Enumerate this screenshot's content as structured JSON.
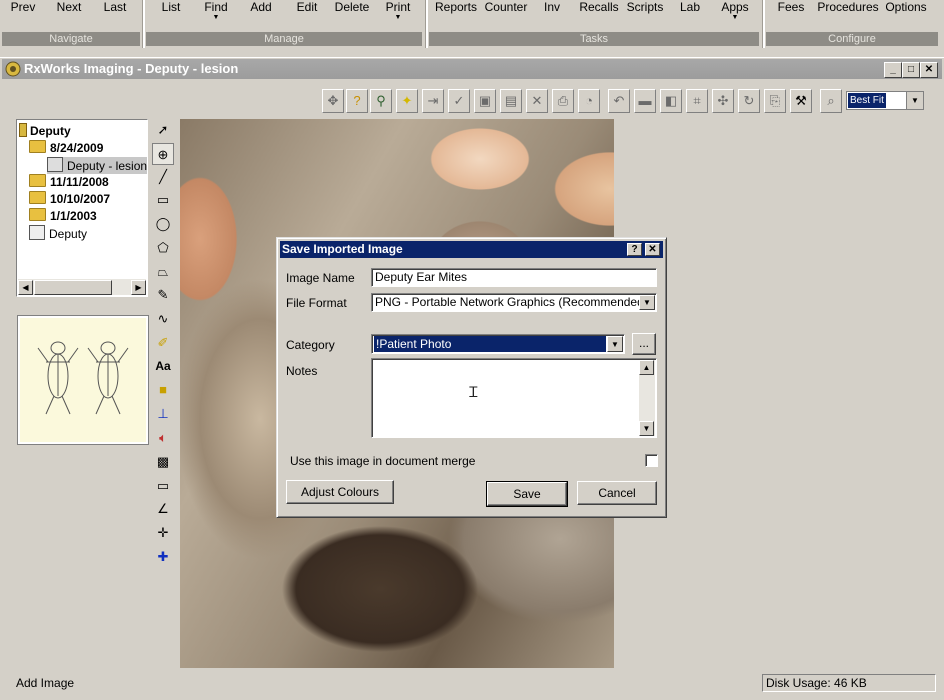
{
  "ribbon": {
    "buttons": [
      {
        "label": "Prev",
        "dropdown": false
      },
      {
        "label": "Next",
        "dropdown": false
      },
      {
        "label": "Last",
        "dropdown": false
      },
      {
        "label": "List",
        "dropdown": false
      },
      {
        "label": "Find",
        "dropdown": true
      },
      {
        "label": "Add",
        "dropdown": false
      },
      {
        "label": "Edit",
        "dropdown": false
      },
      {
        "label": "Delete",
        "dropdown": false
      },
      {
        "label": "Print",
        "dropdown": true
      },
      {
        "label": "Reports",
        "dropdown": false
      },
      {
        "label": "Counter",
        "dropdown": false
      },
      {
        "label": "Inv",
        "dropdown": false
      },
      {
        "label": "Recalls",
        "dropdown": false
      },
      {
        "label": "Scripts",
        "dropdown": false
      },
      {
        "label": "Lab",
        "dropdown": false
      },
      {
        "label": "Apps",
        "dropdown": true
      },
      {
        "label": "Fees",
        "dropdown": false
      },
      {
        "label": "Procedures",
        "dropdown": false
      },
      {
        "label": "Options",
        "dropdown": false
      }
    ],
    "groups": [
      "Navigate",
      "Manage",
      "Tasks",
      "Configure"
    ]
  },
  "window": {
    "title": "RxWorks Imaging - Deputy - lesion",
    "min": "_",
    "max": "□",
    "close": "✕"
  },
  "toolbar": {
    "zoom_value": "Best Fit"
  },
  "tree": {
    "root": "Deputy",
    "items": [
      {
        "label": "8/24/2009"
      },
      {
        "label": "Deputy - lesion"
      },
      {
        "label": "11/11/2008"
      },
      {
        "label": "10/10/2007"
      },
      {
        "label": "1/1/2003"
      },
      {
        "label": "Deputy"
      }
    ]
  },
  "dialog": {
    "title": "Save Imported Image",
    "help": "?",
    "close": "✕",
    "image_name_label": "Image Name",
    "image_name_value": "Deputy Ear Mites",
    "file_format_label": "File Format",
    "file_format_value": "PNG - Portable Network Graphics (Recommended)",
    "category_label": "Category",
    "category_value": "!Patient Photo",
    "category_more": "...",
    "notes_label": "Notes",
    "notes_value": "",
    "merge_label": "Use this image in document merge",
    "merge_checked": false,
    "adjust_button": "Adjust Colours",
    "save_button": "Save",
    "cancel_button": "Cancel"
  },
  "status": {
    "left": "Add Image",
    "disk_usage": "Disk Usage: 46 KB"
  },
  "colors": {
    "dialog_title": "#0a246a",
    "selection": "#0a246a",
    "chrome": "#d4d0c8"
  }
}
